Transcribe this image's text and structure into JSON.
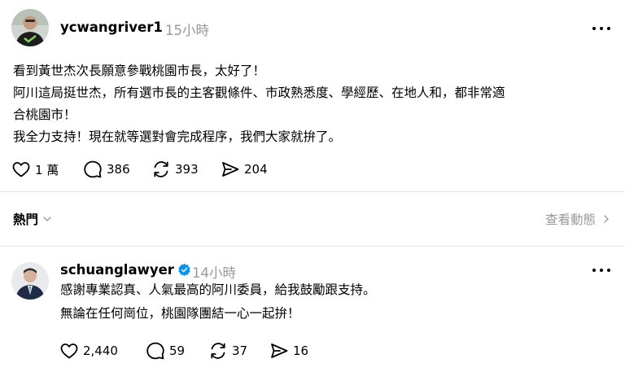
{
  "post": {
    "username": "ycwangriver1",
    "time": "15小時",
    "lines": [
      "看到黃世杰次長願意參戰桃園市長，太好了！",
      "阿川這局挺世杰，所有選市長的主客觀條件、市政熟悉度、學經歷、在地人和，都非常適",
      "合桃園市！",
      "我全力支持！現在就等選對會完成程序，我們大家就拚了。"
    ],
    "likes": "1 萬",
    "comments": "386",
    "reposts": "393",
    "shares": "204"
  },
  "sort": {
    "label": "熱門",
    "activity_label": "查看動態"
  },
  "reply": {
    "username": "schuanglawyer",
    "time": "14小時",
    "lines": [
      "感謝專業認真、人氣最高的阿川委員，給我鼓勵跟支持。",
      "無論在任何崗位，桃園隊團結一心一起拚！"
    ],
    "likes": "2,440",
    "comments": "59",
    "reposts": "37",
    "shares": "16"
  },
  "colors": {
    "verified_blue": "#0095f6",
    "muted_gray": "#999999",
    "divider": "#e5e5e5"
  },
  "icons": [
    "heart-icon",
    "comment-icon",
    "repost-icon",
    "share-icon",
    "more-icon",
    "chevron-down-icon",
    "chevron-right-icon",
    "verified-badge-icon"
  ]
}
